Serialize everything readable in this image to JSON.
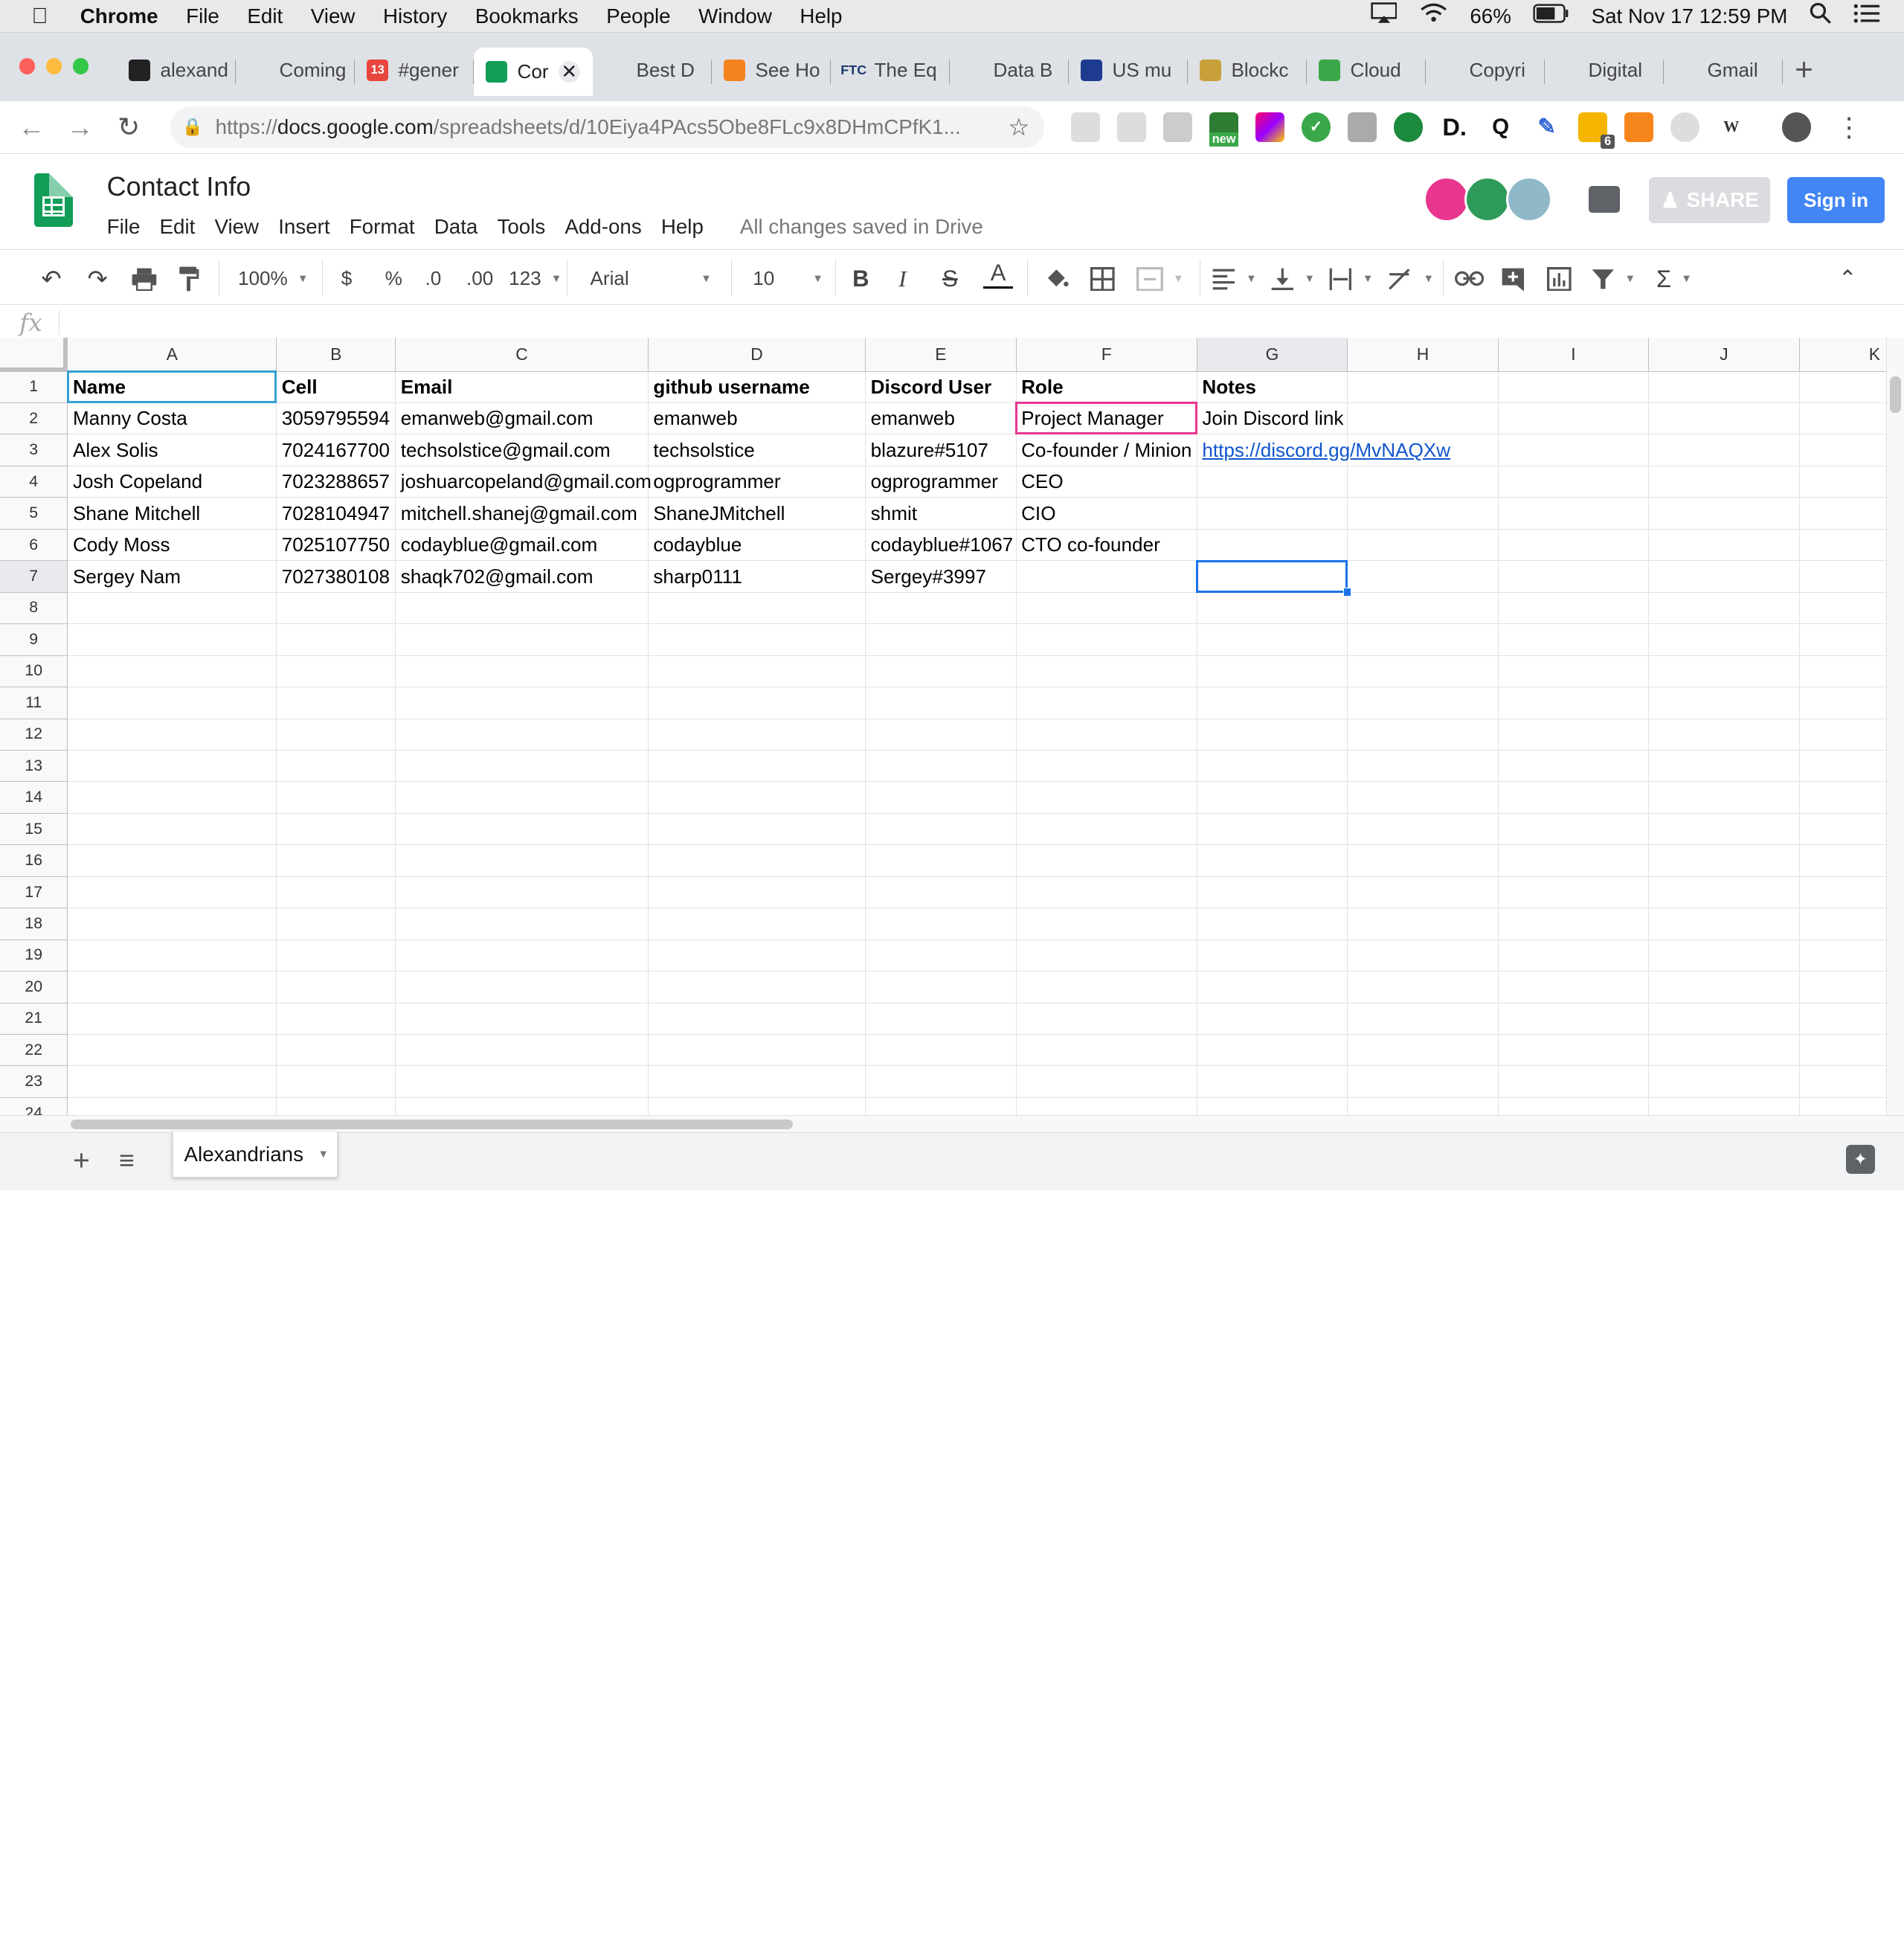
{
  "menubar": {
    "app": "Chrome",
    "items": [
      "File",
      "Edit",
      "View",
      "History",
      "Bookmarks",
      "People",
      "Window",
      "Help"
    ],
    "battery": "66%",
    "datetime": "Sat Nov 17  12:59 PM"
  },
  "tabs": [
    {
      "label": "alexand",
      "icon": "github-icon",
      "color": "#222222"
    },
    {
      "label": "Coming",
      "icon": "document-icon",
      "color": "#666666"
    },
    {
      "label": "#gener",
      "icon": "chat-badge-icon",
      "color": "#e8453c",
      "badge": "13"
    },
    {
      "label": "Cor",
      "icon": "sheets-icon",
      "color": "#0f9d58",
      "active": true
    },
    {
      "label": "Best D",
      "icon": "paper-plane-icon",
      "color": "#2a8af6"
    },
    {
      "label": "See Ho",
      "icon": "c-logo-icon",
      "color": "#f58220"
    },
    {
      "label": "The Eq",
      "icon": "ftc-logo-icon",
      "color": "#1d3c6e",
      "fav_text": "FTC"
    },
    {
      "label": "Data B",
      "icon": "o-logo-icon",
      "color": "#222222"
    },
    {
      "label": "US mu",
      "icon": "m-logo-icon",
      "color": "#1d3b8f"
    },
    {
      "label": "Blockc",
      "icon": "diamond-logo-icon",
      "color": "#c8a03a"
    },
    {
      "label": "Cloud",
      "icon": "w-green-logo-icon",
      "color": "#3aa84a"
    },
    {
      "label": "Copyri",
      "icon": "wikipedia-icon",
      "color": "#666666"
    },
    {
      "label": "Digital",
      "icon": "wikipedia-icon",
      "color": "#666666"
    },
    {
      "label": "Gmail",
      "icon": "google-icon",
      "color": "#4285f4"
    }
  ],
  "address": {
    "prefix": "https://",
    "host": "docs.google.com",
    "path": "/spreadsheets/d/10Eiya4PAcs5Obe8FLc9x8DHmCPfK1..."
  },
  "extensions_badges": {
    "new": "new",
    "count": "6"
  },
  "doc": {
    "title": "Contact Info",
    "menu": [
      "File",
      "Edit",
      "View",
      "Insert",
      "Format",
      "Data",
      "Tools",
      "Add-ons",
      "Help"
    ],
    "saved_status": "All changes saved in Drive",
    "share_label": "SHARE",
    "signin_label": "Sign in"
  },
  "toolbar": {
    "zoom": "100%",
    "currency": "$",
    "percent": "%",
    "dec_less": ".0",
    "dec_more": ".00",
    "more_formats": "123",
    "font": "Arial",
    "font_size": "10",
    "bold": "B",
    "italic": "I",
    "strike": "S",
    "text_color": "A",
    "sum": "Σ"
  },
  "formula_bar": {
    "label": "fx",
    "value": ""
  },
  "sheet": {
    "columns": [
      "A",
      "B",
      "C",
      "D",
      "E",
      "F",
      "G",
      "H",
      "I",
      "J",
      "K"
    ],
    "rows": [
      "1",
      "2",
      "3",
      "4",
      "5",
      "6",
      "7",
      "8",
      "9",
      "10",
      "11",
      "12",
      "13",
      "14",
      "15",
      "16",
      "17",
      "18",
      "19",
      "20",
      "21",
      "22",
      "23",
      "24"
    ],
    "header": [
      "Name",
      "Cell",
      "Email",
      "github username",
      "Discord User",
      "Role",
      "Notes"
    ],
    "data": [
      [
        "Manny Costa",
        "3059795594",
        "emanweb@gmail.com",
        "emanweb",
        "emanweb",
        "Project Manager",
        "Join Discord link"
      ],
      [
        "Alex  Solis",
        "7024167700",
        "techsolstice@gmail.com",
        "techsolstice",
        "blazure#5107",
        "Co-founder / Minion",
        "https://discord.gg/MvNAQXw"
      ],
      [
        "Josh Copeland",
        "7023288657",
        "joshuarcopeland@gmail.com",
        "ogprogrammer",
        "ogprogrammer",
        "CEO",
        ""
      ],
      [
        "Shane Mitchell",
        "7028104947",
        "mitchell.shanej@gmail.com",
        "ShaneJMitchell",
        "shmit",
        "CIO",
        ""
      ],
      [
        "Cody Moss",
        "7025107750",
        "codayblue@gmail.com",
        "codayblue",
        "codayblue#1067",
        "CTO co-founder",
        ""
      ],
      [
        "Sergey Nam",
        "7027380108",
        "shaqk702@gmail.com",
        "sharp0111",
        "Sergey#3997",
        "",
        ""
      ]
    ],
    "active_cell": "G7",
    "sheet_tab": "Alexandrians"
  },
  "colors": {
    "accent": "#1a73e8",
    "collaborator": "#e8368f",
    "signin": "#4285f4",
    "link": "#1155cc"
  }
}
